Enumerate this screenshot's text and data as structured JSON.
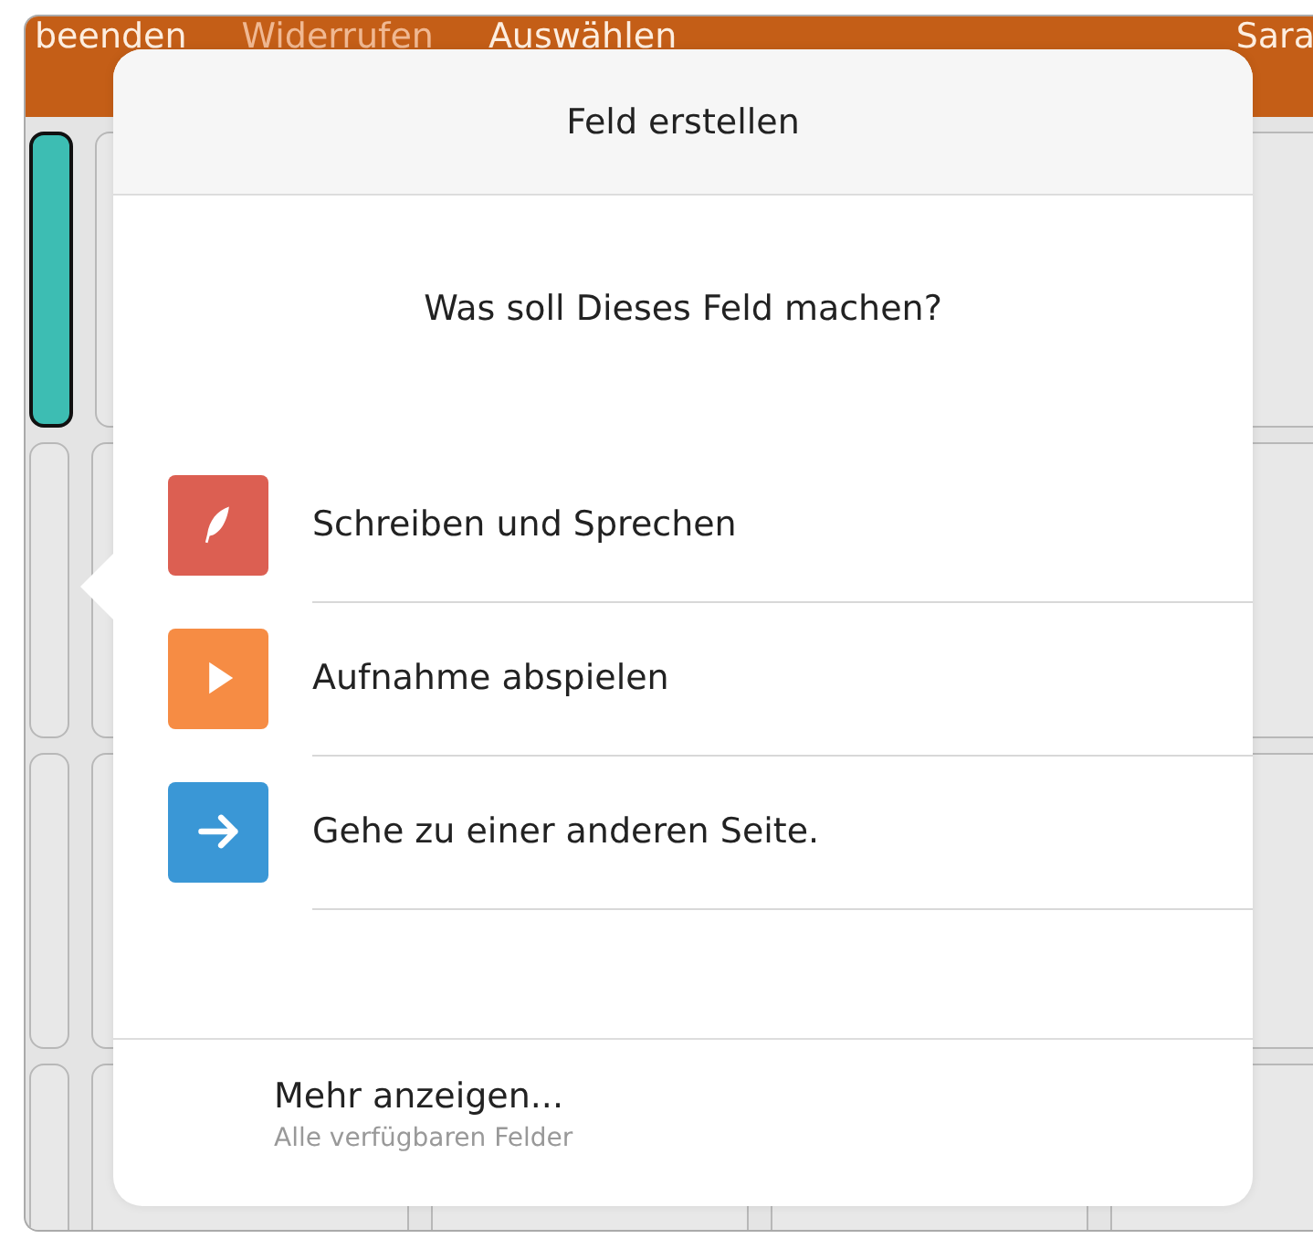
{
  "toolbar": {
    "items": [
      {
        "label": "beenden",
        "disabled": false
      },
      {
        "label": "Widerrufen",
        "disabled": true
      },
      {
        "label": "Auswählen",
        "disabled": false
      }
    ],
    "user": "Sara"
  },
  "popover": {
    "title": "Feld erstellen",
    "question": "Was soll Dieses Feld machen?",
    "options": [
      {
        "kind": "quill",
        "label": "Schreiben und Sprechen",
        "color": "#dc5f52"
      },
      {
        "kind": "play",
        "label": "Aufnahme abspielen",
        "color": "#f68c44"
      },
      {
        "kind": "arrow",
        "label": "Gehe zu einer anderen Seite.",
        "color": "#3a97d6"
      }
    ],
    "more": {
      "label": "Mehr anzeigen...",
      "subtitle": "Alle verfügbaren Felder"
    }
  }
}
